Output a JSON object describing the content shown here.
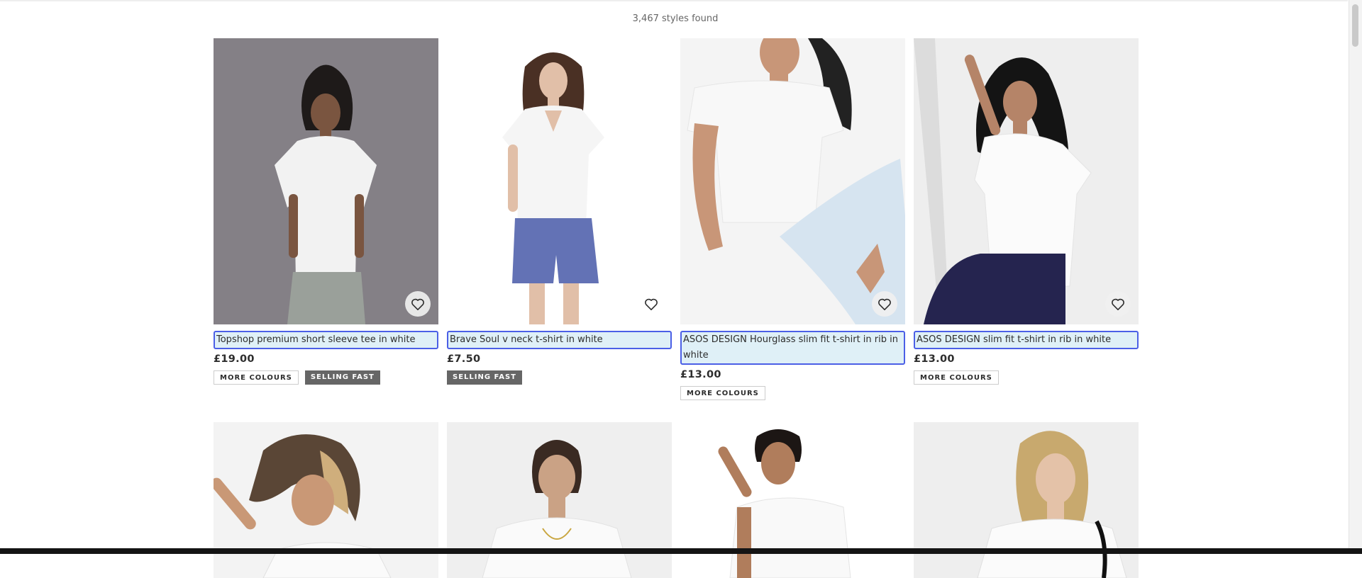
{
  "results": {
    "count_text": "3,467 styles found"
  },
  "products": [
    {
      "title": "Topshop premium short sleeve tee in white",
      "price": "£19.00",
      "badges": [
        "MORE COLOURS",
        "SELLING FAST"
      ]
    },
    {
      "title": "Brave Soul v neck t-shirt in white",
      "price": "£7.50",
      "badges": [
        "SELLING FAST"
      ]
    },
    {
      "title": "ASOS DESIGN Hourglass slim fit t-shirt in rib in white",
      "price": "£13.00",
      "badges": [
        "MORE COLOURS"
      ]
    },
    {
      "title": "ASOS DESIGN slim fit t-shirt in rib in white",
      "price": "£13.00",
      "badges": [
        "MORE COLOURS"
      ]
    }
  ],
  "icons": {
    "save": "heart-outline-icon"
  },
  "colors": {
    "focus_outline": "#4b5fe6",
    "title_highlight": "#dff0f7",
    "selling_fast_badge": "#666666",
    "text": "#2d2d2d"
  }
}
